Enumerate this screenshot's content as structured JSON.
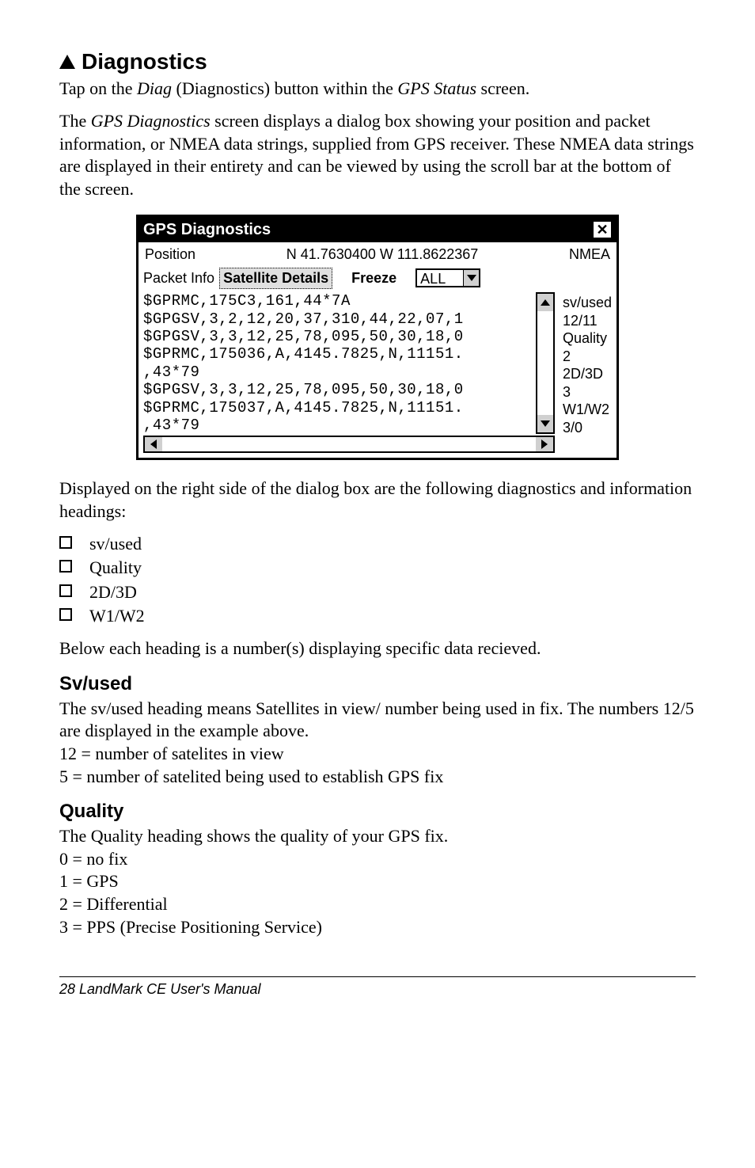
{
  "heading": "Diagnostics",
  "para1_pre": "Tap on the ",
  "para1_diag": "Diag",
  "para1_mid": " (Diagnostics) button within the ",
  "para1_gps": "GPS Status",
  "para1_post": " screen.",
  "para2_pre": "The ",
  "para2_gpsdiag": "GPS Diagnostics",
  "para2_post": " screen displays a dialog box showing your position and packet information, or NMEA data strings, supplied from GPS receiver. These NMEA data strings are displayed in their entirety and can be viewed by using the scroll bar at the bottom of the screen.",
  "screenshot": {
    "title": "GPS Diagnostics",
    "close": "✕",
    "position_label": "Position",
    "position_value": "N  41.7630400 W  111.8622367",
    "nmea_label": "NMEA",
    "packet_info": "Packet Info",
    "details_btn": "Satellite Details",
    "freeze_btn": "Freeze",
    "dropdown": "ALL",
    "nmea_lines": "$GPRMC,175C3,161,44*7A\n$GPGSV,3,2,12,20,37,310,44,22,07,1\n$GPGSV,3,3,12,25,78,095,50,30,18,0\n$GPRMC,175036,A,4145.7825,N,11151.\n,43*79\n$GPGSV,3,3,12,25,78,095,50,30,18,0\n$GPRMC,175037,A,4145.7825,N,11151.\n,43*79",
    "stats": "sv/used\n12/11\nQuality\n2\n2D/3D\n3\nW1/W2\n3/0"
  },
  "para3": "Displayed on the right side of the dialog box are the following diagnostics and information headings:",
  "checklist": {
    "item1": "sv/used",
    "item2": "Quality",
    "item3": "2D/3D",
    "item4": "W1/W2"
  },
  "para4": "Below each heading is a number(s) displaying specific data recieved.",
  "svused": {
    "heading": "Sv/used",
    "line1": "The sv/used heading means Satellites in view/ number being used in fix. The numbers 12/5 are displayed in the example above.",
    "line2": "12 = number of satelites in view",
    "line3": "5 = number of satelited being used to establish GPS fix"
  },
  "quality": {
    "heading": "Quality",
    "line1": "The Quality heading shows the quality of your GPS fix.",
    "line2": "0 = no fix",
    "line3": "1 = GPS",
    "line4": "2 = Differential",
    "line5": "3 = PPS (Precise Positioning Service)"
  },
  "footer": "28  LandMark CE User's Manual"
}
